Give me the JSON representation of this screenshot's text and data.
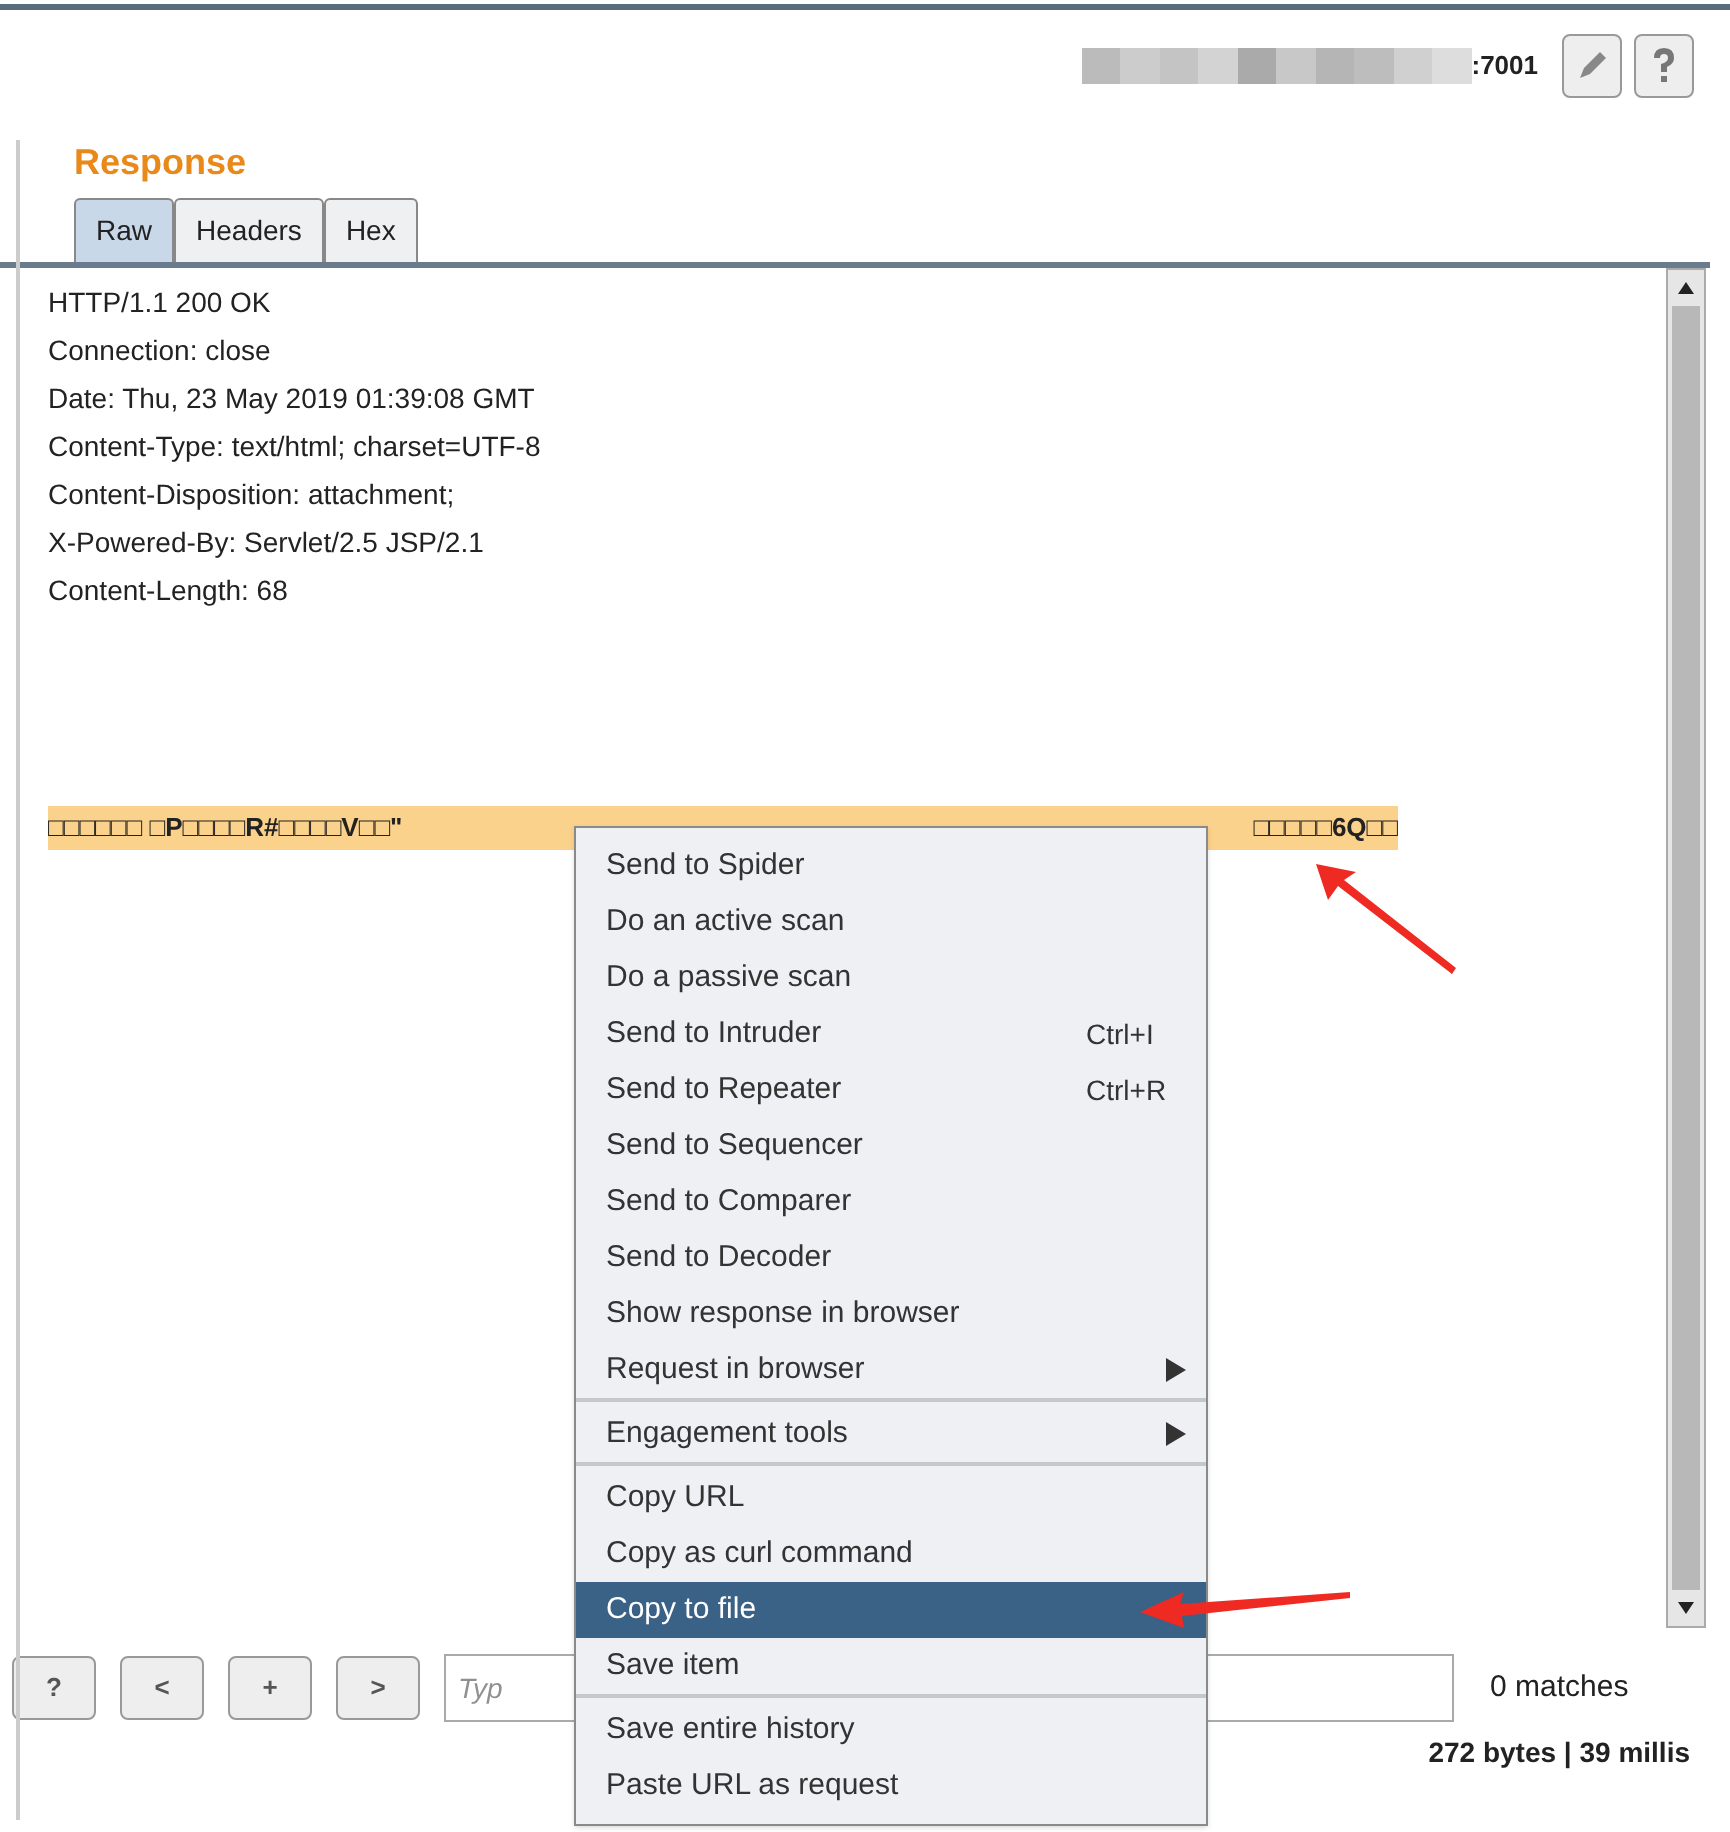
{
  "header": {
    "host_suffix": ":7001"
  },
  "panel": {
    "title": "Response"
  },
  "tabs": [
    {
      "label": "Raw",
      "selected": true
    },
    {
      "label": "Headers",
      "selected": false
    },
    {
      "label": "Hex",
      "selected": false
    }
  ],
  "response_lines": [
    "HTTP/1.1 200 OK",
    "Connection: close",
    "Date: Thu, 23 May 2019 01:39:08 GMT",
    "Content-Type: text/html; charset=UTF-8",
    "Content-Disposition: attachment;",
    "X-Powered-By: Servlet/2.5 JSP/2.1",
    "Content-Length: 68"
  ],
  "body_line": {
    "left": "□□□□□□ □P□□□□R#□□□□V□□\"",
    "right": "□□□□□6Q□□"
  },
  "search_bar": {
    "buttons": [
      "?",
      "<",
      "+",
      ">"
    ],
    "placeholder": "Typ",
    "matches": "0 matches"
  },
  "status": "272 bytes | 39 millis",
  "context_menu": [
    [
      {
        "label": "Send to Spider",
        "selected": false
      },
      {
        "label": "Do an active scan",
        "selected": false
      },
      {
        "label": "Do a passive scan",
        "selected": false
      },
      {
        "label": "Send to Intruder",
        "shortcut": "Ctrl+I",
        "selected": false
      },
      {
        "label": "Send to Repeater",
        "shortcut": "Ctrl+R",
        "selected": false
      },
      {
        "label": "Send to Sequencer",
        "selected": false
      },
      {
        "label": "Send to Comparer",
        "selected": false
      },
      {
        "label": "Send to Decoder",
        "selected": false
      },
      {
        "label": "Show response in browser",
        "selected": false
      },
      {
        "label": "Request in browser",
        "submenu": true,
        "selected": false
      }
    ],
    [
      {
        "label": "Engagement tools",
        "submenu": true,
        "selected": false
      }
    ],
    [
      {
        "label": "Copy URL",
        "selected": false
      },
      {
        "label": "Copy as curl command",
        "selected": false
      },
      {
        "label": "Copy to file",
        "selected": true
      },
      {
        "label": "Save item",
        "selected": false
      }
    ],
    [
      {
        "label": "Save entire history",
        "selected": false
      },
      {
        "label": "Paste URL as request",
        "selected": false
      }
    ]
  ]
}
